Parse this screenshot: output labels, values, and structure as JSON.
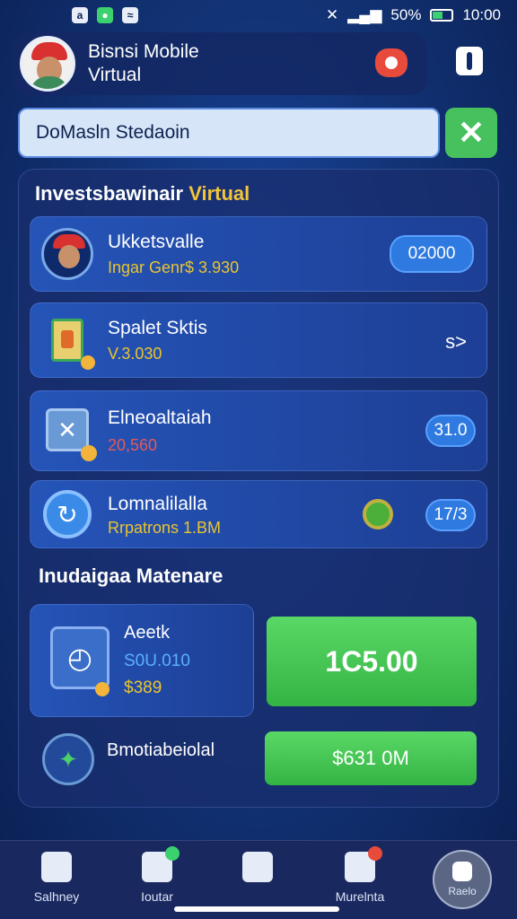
{
  "status_bar": {
    "left_icons": [
      "app-icon",
      "signal-icon",
      "wifi-icon"
    ],
    "battery": "50%",
    "battery_level": 0.5,
    "time": "10:00"
  },
  "header": {
    "title_line1": "Bisnsi Mobile",
    "title_line2": "Virtual"
  },
  "search": {
    "value": "DoMasln Stedaoin",
    "close_icon": "close-icon"
  },
  "panel": {
    "title_main": "Investsbawinair",
    "title_accent": "Virtual",
    "cards": [
      {
        "title": "Ukketsvalle",
        "sub": "Ingar Genr$ 3.930",
        "pill": "02000",
        "icon": "avatar-icon"
      },
      {
        "title": "Spalet Sktis",
        "sub": "V.3.030",
        "action": "s>",
        "icon": "document-icon"
      },
      {
        "title": "Elneoaltaiah",
        "sub": "20,560",
        "pill": "31.0",
        "icon": "box-icon"
      },
      {
        "title": "Lomnalilalla",
        "sub": "Rrpatrons 1.BM",
        "pill": "17/3",
        "icon": "refresh-icon"
      }
    ]
  },
  "section2": {
    "title": "Inudaigaa Matenare",
    "card": {
      "title": "Aeetk",
      "value1": "S0U.010",
      "value2": "$389"
    },
    "primary_button": "1C5.00",
    "row_title": "Bmotiabeiolal",
    "secondary_button": "$631 0M"
  },
  "bottom_nav": {
    "items": [
      {
        "label": "Salhney",
        "icon": "home-icon"
      },
      {
        "label": "Ioutar",
        "icon": "building-icon"
      },
      {
        "label": "",
        "icon": "grid-icon"
      },
      {
        "label": "Murelnta",
        "icon": "badge-icon"
      }
    ],
    "fab_label": "Raelo"
  },
  "colors": {
    "accent_yellow": "#f2c43a",
    "button_green": "#46c15e",
    "pill_blue": "#2f7ae0",
    "background": "#123477"
  }
}
